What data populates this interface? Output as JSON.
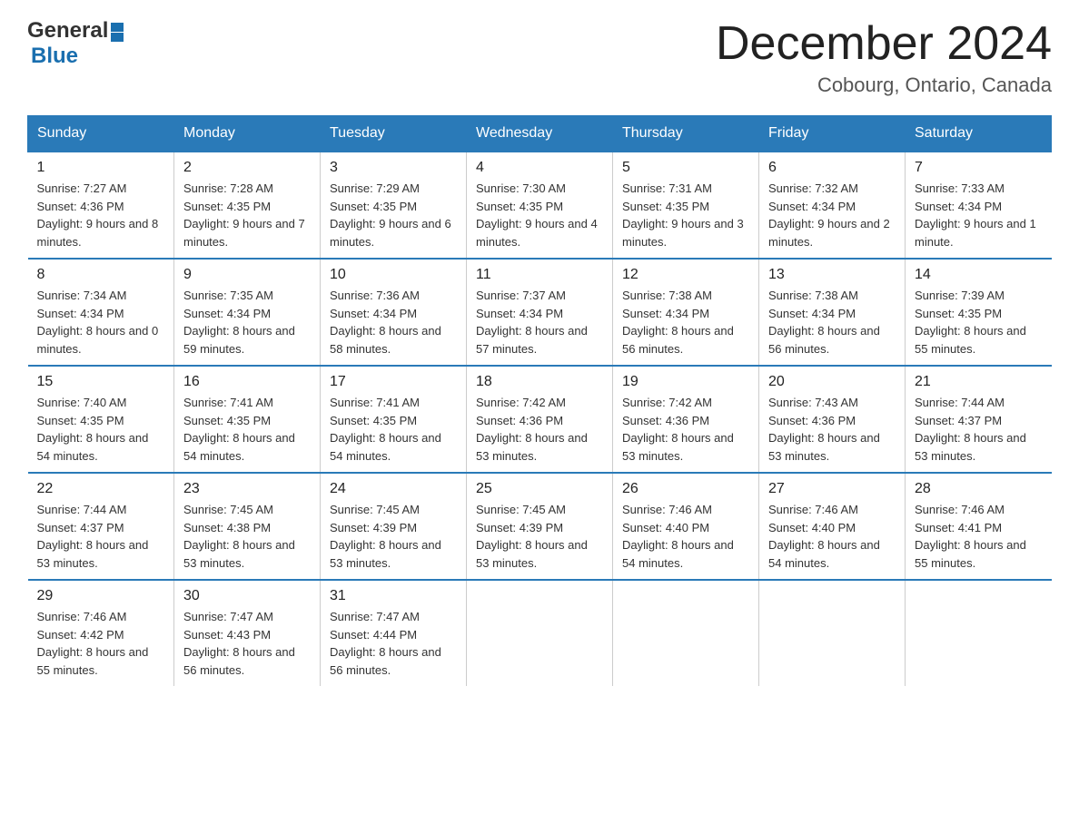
{
  "header": {
    "logo_general": "General",
    "logo_blue": "Blue",
    "month_title": "December 2024",
    "location": "Cobourg, Ontario, Canada"
  },
  "weekdays": [
    "Sunday",
    "Monday",
    "Tuesday",
    "Wednesday",
    "Thursday",
    "Friday",
    "Saturday"
  ],
  "weeks": [
    [
      {
        "day": "1",
        "sunrise": "7:27 AM",
        "sunset": "4:36 PM",
        "daylight": "9 hours and 8 minutes."
      },
      {
        "day": "2",
        "sunrise": "7:28 AM",
        "sunset": "4:35 PM",
        "daylight": "9 hours and 7 minutes."
      },
      {
        "day": "3",
        "sunrise": "7:29 AM",
        "sunset": "4:35 PM",
        "daylight": "9 hours and 6 minutes."
      },
      {
        "day": "4",
        "sunrise": "7:30 AM",
        "sunset": "4:35 PM",
        "daylight": "9 hours and 4 minutes."
      },
      {
        "day": "5",
        "sunrise": "7:31 AM",
        "sunset": "4:35 PM",
        "daylight": "9 hours and 3 minutes."
      },
      {
        "day": "6",
        "sunrise": "7:32 AM",
        "sunset": "4:34 PM",
        "daylight": "9 hours and 2 minutes."
      },
      {
        "day": "7",
        "sunrise": "7:33 AM",
        "sunset": "4:34 PM",
        "daylight": "9 hours and 1 minute."
      }
    ],
    [
      {
        "day": "8",
        "sunrise": "7:34 AM",
        "sunset": "4:34 PM",
        "daylight": "8 hours and 0 minutes."
      },
      {
        "day": "9",
        "sunrise": "7:35 AM",
        "sunset": "4:34 PM",
        "daylight": "8 hours and 59 minutes."
      },
      {
        "day": "10",
        "sunrise": "7:36 AM",
        "sunset": "4:34 PM",
        "daylight": "8 hours and 58 minutes."
      },
      {
        "day": "11",
        "sunrise": "7:37 AM",
        "sunset": "4:34 PM",
        "daylight": "8 hours and 57 minutes."
      },
      {
        "day": "12",
        "sunrise": "7:38 AM",
        "sunset": "4:34 PM",
        "daylight": "8 hours and 56 minutes."
      },
      {
        "day": "13",
        "sunrise": "7:38 AM",
        "sunset": "4:34 PM",
        "daylight": "8 hours and 56 minutes."
      },
      {
        "day": "14",
        "sunrise": "7:39 AM",
        "sunset": "4:35 PM",
        "daylight": "8 hours and 55 minutes."
      }
    ],
    [
      {
        "day": "15",
        "sunrise": "7:40 AM",
        "sunset": "4:35 PM",
        "daylight": "8 hours and 54 minutes."
      },
      {
        "day": "16",
        "sunrise": "7:41 AM",
        "sunset": "4:35 PM",
        "daylight": "8 hours and 54 minutes."
      },
      {
        "day": "17",
        "sunrise": "7:41 AM",
        "sunset": "4:35 PM",
        "daylight": "8 hours and 54 minutes."
      },
      {
        "day": "18",
        "sunrise": "7:42 AM",
        "sunset": "4:36 PM",
        "daylight": "8 hours and 53 minutes."
      },
      {
        "day": "19",
        "sunrise": "7:42 AM",
        "sunset": "4:36 PM",
        "daylight": "8 hours and 53 minutes."
      },
      {
        "day": "20",
        "sunrise": "7:43 AM",
        "sunset": "4:36 PM",
        "daylight": "8 hours and 53 minutes."
      },
      {
        "day": "21",
        "sunrise": "7:44 AM",
        "sunset": "4:37 PM",
        "daylight": "8 hours and 53 minutes."
      }
    ],
    [
      {
        "day": "22",
        "sunrise": "7:44 AM",
        "sunset": "4:37 PM",
        "daylight": "8 hours and 53 minutes."
      },
      {
        "day": "23",
        "sunrise": "7:45 AM",
        "sunset": "4:38 PM",
        "daylight": "8 hours and 53 minutes."
      },
      {
        "day": "24",
        "sunrise": "7:45 AM",
        "sunset": "4:39 PM",
        "daylight": "8 hours and 53 minutes."
      },
      {
        "day": "25",
        "sunrise": "7:45 AM",
        "sunset": "4:39 PM",
        "daylight": "8 hours and 53 minutes."
      },
      {
        "day": "26",
        "sunrise": "7:46 AM",
        "sunset": "4:40 PM",
        "daylight": "8 hours and 54 minutes."
      },
      {
        "day": "27",
        "sunrise": "7:46 AM",
        "sunset": "4:40 PM",
        "daylight": "8 hours and 54 minutes."
      },
      {
        "day": "28",
        "sunrise": "7:46 AM",
        "sunset": "4:41 PM",
        "daylight": "8 hours and 55 minutes."
      }
    ],
    [
      {
        "day": "29",
        "sunrise": "7:46 AM",
        "sunset": "4:42 PM",
        "daylight": "8 hours and 55 minutes."
      },
      {
        "day": "30",
        "sunrise": "7:47 AM",
        "sunset": "4:43 PM",
        "daylight": "8 hours and 56 minutes."
      },
      {
        "day": "31",
        "sunrise": "7:47 AM",
        "sunset": "4:44 PM",
        "daylight": "8 hours and 56 minutes."
      },
      {
        "day": "",
        "sunrise": "",
        "sunset": "",
        "daylight": ""
      },
      {
        "day": "",
        "sunrise": "",
        "sunset": "",
        "daylight": ""
      },
      {
        "day": "",
        "sunrise": "",
        "sunset": "",
        "daylight": ""
      },
      {
        "day": "",
        "sunrise": "",
        "sunset": "",
        "daylight": ""
      }
    ]
  ],
  "labels": {
    "sunrise": "Sunrise: ",
    "sunset": "Sunset: ",
    "daylight": "Daylight: "
  }
}
